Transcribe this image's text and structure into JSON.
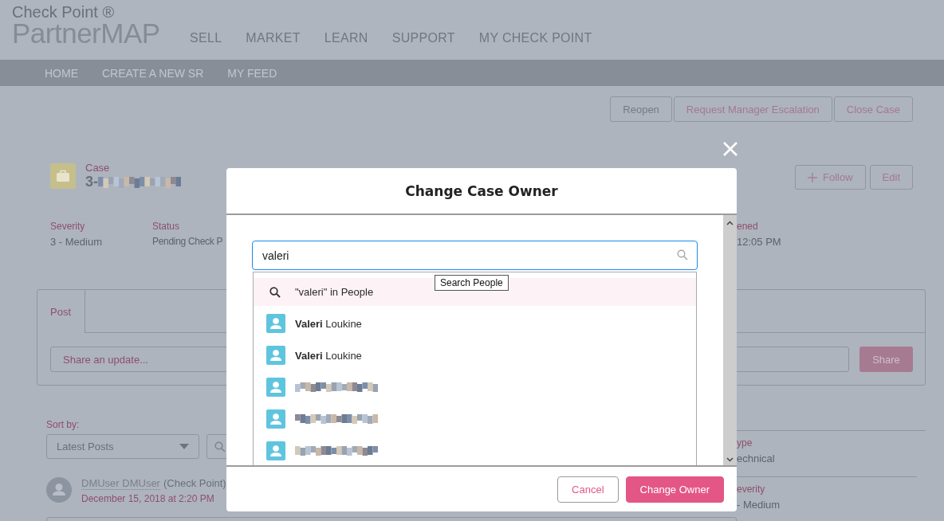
{
  "header": {
    "brand_top": "Check Point ®",
    "brand": "PartnerMAP",
    "nav": [
      "SELL",
      "MARKET",
      "LEARN",
      "SUPPORT",
      "MY CHECK POINT"
    ]
  },
  "subnav": [
    "HOME",
    "CREATE A NEW SR",
    "MY FEED"
  ],
  "actions": [
    {
      "label": "Reopen",
      "disabled": true
    },
    {
      "label": "Request Manager Escalation",
      "disabled": false
    },
    {
      "label": "Close Case",
      "disabled": false
    }
  ],
  "record": {
    "type": "Case",
    "number": "3-"
  },
  "record_actions": [
    {
      "label": "Follow",
      "kind": "follow"
    },
    {
      "label": "Edit",
      "kind": "plain"
    }
  ],
  "fields": [
    {
      "label": "Severity",
      "value": "3 - Medium"
    },
    {
      "label": "Status",
      "value": "Pending Check P"
    },
    {
      "label": "ened",
      "value": "12:05 PM"
    }
  ],
  "publisher": {
    "tabs": [
      {
        "label": "Post",
        "selected": true
      }
    ],
    "placeholder": "Share an update...",
    "button": "Share"
  },
  "feed": {
    "sort_label": "Sort by:",
    "sort_value": "Latest Posts",
    "post": {
      "author": "DMUser DMUser",
      "org": "(Check Point)",
      "date": "December 15, 2018 at 2:20 PM"
    }
  },
  "details": [
    {
      "label": "ype",
      "value": "echnical"
    },
    {
      "label": "everity",
      "value": "- Medium"
    }
  ],
  "modal": {
    "title": "Change Case Owner",
    "search_value": "valeri",
    "tooltip": "Search People",
    "results": [
      {
        "kind": "search",
        "text": "\"valeri\" in People",
        "selected": true
      },
      {
        "kind": "person",
        "name": "**Valeri** Loukine",
        "selected": false
      },
      {
        "kind": "person",
        "name": "**Valeri** Loukine",
        "selected": false
      },
      {
        "kind": "redacted",
        "selected": false
      },
      {
        "kind": "redacted",
        "selected": false
      },
      {
        "kind": "redacted",
        "selected": false
      }
    ],
    "buttons": [
      {
        "label": "Cancel",
        "kind": "secondary"
      },
      {
        "label": "Change Owner",
        "kind": "primary"
      }
    ]
  }
}
